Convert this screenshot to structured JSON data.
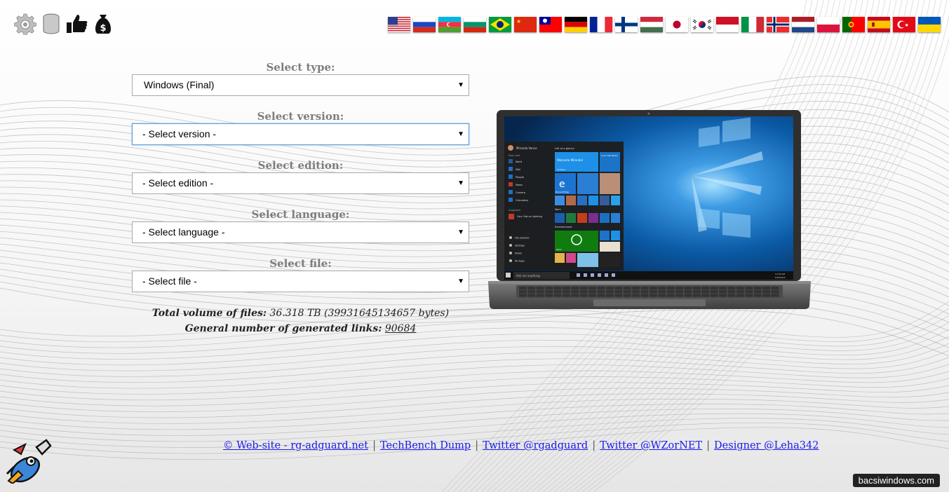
{
  "toolbar": {
    "icons": [
      "gear-icon",
      "database-icon",
      "thumbs-up-icon",
      "money-bag-icon"
    ]
  },
  "flags": [
    "us",
    "ru",
    "az",
    "bg",
    "br",
    "cn",
    "tw",
    "de",
    "fr",
    "fi",
    "hu",
    "jp",
    "kr",
    "id",
    "it",
    "no",
    "nl",
    "pl",
    "pt",
    "es",
    "tr",
    "ua"
  ],
  "form": {
    "type": {
      "label": "Select type:",
      "value": "Windows (Final)"
    },
    "version": {
      "label": "Select version:",
      "value": "- Select version -"
    },
    "edition": {
      "label": "Select edition:",
      "value": "- Select edition -"
    },
    "language": {
      "label": "Select language:",
      "value": "- Select language -"
    },
    "file": {
      "label": "Select file:",
      "value": "- Select file -"
    }
  },
  "stats": {
    "volume_label": "Total volume of files:",
    "volume_value": "36.318 TB (39931645134657 bytes)",
    "links_label": "General number of generated links:",
    "links_value": "90684"
  },
  "footer": {
    "links": [
      "© Web-site - rg-adguard.net",
      "TechBench Dump",
      "Twitter @rgadguard",
      "Twitter @WZorNET",
      "Designer @Leha342"
    ],
    "separator": "|"
  },
  "laptop": {
    "start_menu_user": "Miranda Vance",
    "start_menu_section": "Most used",
    "start_items": [
      "Word",
      "Mail",
      "People",
      "News",
      "Camera",
      "Calculator"
    ],
    "suggested": "Suggested",
    "suggested_item": "Cars: Fast as Lightning",
    "bottom_items": [
      "File Explorer",
      "Settings",
      "Power",
      "All Apps"
    ],
    "tiles_header": "Life at a glance",
    "tile_welcome": "Welcome Miranda!",
    "tile_cortana": "Cortana",
    "tile_lunch": "Lunch with Barbra",
    "tile_edge": "Microsoft Edge",
    "work_header": "Work",
    "ent_header": "Entertainment",
    "tile_xbox": "Xbox",
    "search_text": "Ask me anything",
    "clock": "12:00 AM",
    "date": "7/29/2015"
  },
  "watermark": "bacsiwindows.com",
  "colors": {
    "label_gray": "#7d7d7d",
    "link_blue": "#1a1aee",
    "focus_blue": "#5b9dd9",
    "desktop_blue": "#0a5fa8"
  }
}
